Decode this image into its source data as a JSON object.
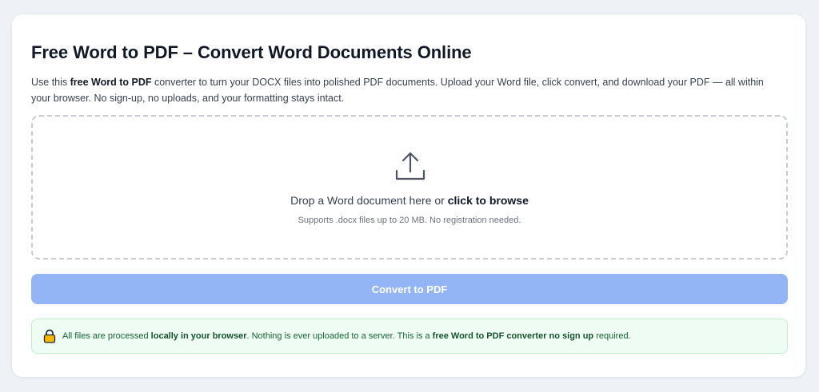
{
  "page": {
    "title": "Free Word to PDF – Convert Word Documents Online",
    "intro_pre": "Use this ",
    "intro_bold": "free Word to PDF",
    "intro_post": " converter to turn your DOCX files into polished PDF documents. Upload your Word file, click convert, and download your PDF — all within your browser. No sign-up, no uploads, and your formatting stays intact."
  },
  "dropzone": {
    "icon": "upload-icon",
    "text_pre": "Drop a Word document here or ",
    "text_link": "click to browse",
    "subtext": "Supports .docx files up to 20 MB. No registration needed."
  },
  "convert_button": {
    "label": "Convert to PDF",
    "state": "disabled"
  },
  "notice": {
    "icon": "lock-icon",
    "text_1": "All files are processed ",
    "bold_1": "locally in your browser",
    "text_2": ". Nothing is ever uploaded to a server. This is a ",
    "bold_2": "free Word to PDF converter no sign up",
    "text_3": " required."
  },
  "colors": {
    "button_disabled": "#93b4f5",
    "notice_bg": "#effcf3",
    "notice_border": "#bfeccd",
    "notice_text": "#166534",
    "lock_fill": "#f5b700"
  }
}
